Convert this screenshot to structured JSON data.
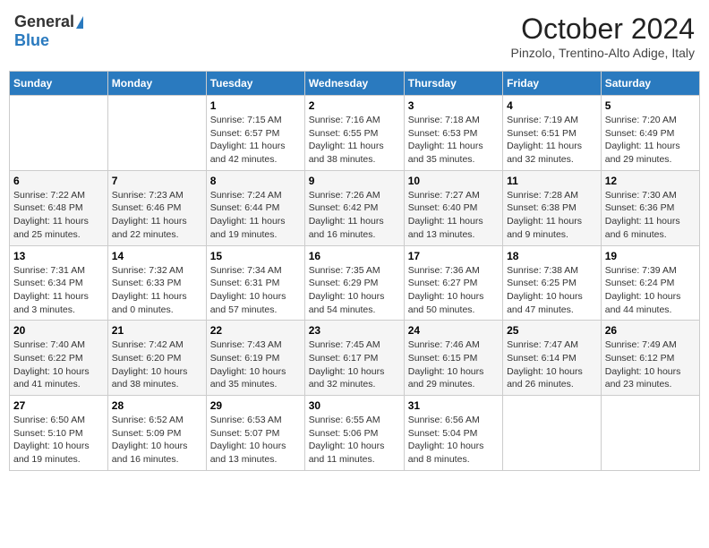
{
  "header": {
    "logo_general": "General",
    "logo_blue": "Blue",
    "month_title": "October 2024",
    "subtitle": "Pinzolo, Trentino-Alto Adige, Italy"
  },
  "days_of_week": [
    "Sunday",
    "Monday",
    "Tuesday",
    "Wednesday",
    "Thursday",
    "Friday",
    "Saturday"
  ],
  "weeks": [
    [
      {
        "day": "",
        "sunrise": "",
        "sunset": "",
        "daylight": ""
      },
      {
        "day": "",
        "sunrise": "",
        "sunset": "",
        "daylight": ""
      },
      {
        "day": "1",
        "sunrise": "Sunrise: 7:15 AM",
        "sunset": "Sunset: 6:57 PM",
        "daylight": "Daylight: 11 hours and 42 minutes."
      },
      {
        "day": "2",
        "sunrise": "Sunrise: 7:16 AM",
        "sunset": "Sunset: 6:55 PM",
        "daylight": "Daylight: 11 hours and 38 minutes."
      },
      {
        "day": "3",
        "sunrise": "Sunrise: 7:18 AM",
        "sunset": "Sunset: 6:53 PM",
        "daylight": "Daylight: 11 hours and 35 minutes."
      },
      {
        "day": "4",
        "sunrise": "Sunrise: 7:19 AM",
        "sunset": "Sunset: 6:51 PM",
        "daylight": "Daylight: 11 hours and 32 minutes."
      },
      {
        "day": "5",
        "sunrise": "Sunrise: 7:20 AM",
        "sunset": "Sunset: 6:49 PM",
        "daylight": "Daylight: 11 hours and 29 minutes."
      }
    ],
    [
      {
        "day": "6",
        "sunrise": "Sunrise: 7:22 AM",
        "sunset": "Sunset: 6:48 PM",
        "daylight": "Daylight: 11 hours and 25 minutes."
      },
      {
        "day": "7",
        "sunrise": "Sunrise: 7:23 AM",
        "sunset": "Sunset: 6:46 PM",
        "daylight": "Daylight: 11 hours and 22 minutes."
      },
      {
        "day": "8",
        "sunrise": "Sunrise: 7:24 AM",
        "sunset": "Sunset: 6:44 PM",
        "daylight": "Daylight: 11 hours and 19 minutes."
      },
      {
        "day": "9",
        "sunrise": "Sunrise: 7:26 AM",
        "sunset": "Sunset: 6:42 PM",
        "daylight": "Daylight: 11 hours and 16 minutes."
      },
      {
        "day": "10",
        "sunrise": "Sunrise: 7:27 AM",
        "sunset": "Sunset: 6:40 PM",
        "daylight": "Daylight: 11 hours and 13 minutes."
      },
      {
        "day": "11",
        "sunrise": "Sunrise: 7:28 AM",
        "sunset": "Sunset: 6:38 PM",
        "daylight": "Daylight: 11 hours and 9 minutes."
      },
      {
        "day": "12",
        "sunrise": "Sunrise: 7:30 AM",
        "sunset": "Sunset: 6:36 PM",
        "daylight": "Daylight: 11 hours and 6 minutes."
      }
    ],
    [
      {
        "day": "13",
        "sunrise": "Sunrise: 7:31 AM",
        "sunset": "Sunset: 6:34 PM",
        "daylight": "Daylight: 11 hours and 3 minutes."
      },
      {
        "day": "14",
        "sunrise": "Sunrise: 7:32 AM",
        "sunset": "Sunset: 6:33 PM",
        "daylight": "Daylight: 11 hours and 0 minutes."
      },
      {
        "day": "15",
        "sunrise": "Sunrise: 7:34 AM",
        "sunset": "Sunset: 6:31 PM",
        "daylight": "Daylight: 10 hours and 57 minutes."
      },
      {
        "day": "16",
        "sunrise": "Sunrise: 7:35 AM",
        "sunset": "Sunset: 6:29 PM",
        "daylight": "Daylight: 10 hours and 54 minutes."
      },
      {
        "day": "17",
        "sunrise": "Sunrise: 7:36 AM",
        "sunset": "Sunset: 6:27 PM",
        "daylight": "Daylight: 10 hours and 50 minutes."
      },
      {
        "day": "18",
        "sunrise": "Sunrise: 7:38 AM",
        "sunset": "Sunset: 6:25 PM",
        "daylight": "Daylight: 10 hours and 47 minutes."
      },
      {
        "day": "19",
        "sunrise": "Sunrise: 7:39 AM",
        "sunset": "Sunset: 6:24 PM",
        "daylight": "Daylight: 10 hours and 44 minutes."
      }
    ],
    [
      {
        "day": "20",
        "sunrise": "Sunrise: 7:40 AM",
        "sunset": "Sunset: 6:22 PM",
        "daylight": "Daylight: 10 hours and 41 minutes."
      },
      {
        "day": "21",
        "sunrise": "Sunrise: 7:42 AM",
        "sunset": "Sunset: 6:20 PM",
        "daylight": "Daylight: 10 hours and 38 minutes."
      },
      {
        "day": "22",
        "sunrise": "Sunrise: 7:43 AM",
        "sunset": "Sunset: 6:19 PM",
        "daylight": "Daylight: 10 hours and 35 minutes."
      },
      {
        "day": "23",
        "sunrise": "Sunrise: 7:45 AM",
        "sunset": "Sunset: 6:17 PM",
        "daylight": "Daylight: 10 hours and 32 minutes."
      },
      {
        "day": "24",
        "sunrise": "Sunrise: 7:46 AM",
        "sunset": "Sunset: 6:15 PM",
        "daylight": "Daylight: 10 hours and 29 minutes."
      },
      {
        "day": "25",
        "sunrise": "Sunrise: 7:47 AM",
        "sunset": "Sunset: 6:14 PM",
        "daylight": "Daylight: 10 hours and 26 minutes."
      },
      {
        "day": "26",
        "sunrise": "Sunrise: 7:49 AM",
        "sunset": "Sunset: 6:12 PM",
        "daylight": "Daylight: 10 hours and 23 minutes."
      }
    ],
    [
      {
        "day": "27",
        "sunrise": "Sunrise: 6:50 AM",
        "sunset": "Sunset: 5:10 PM",
        "daylight": "Daylight: 10 hours and 19 minutes."
      },
      {
        "day": "28",
        "sunrise": "Sunrise: 6:52 AM",
        "sunset": "Sunset: 5:09 PM",
        "daylight": "Daylight: 10 hours and 16 minutes."
      },
      {
        "day": "29",
        "sunrise": "Sunrise: 6:53 AM",
        "sunset": "Sunset: 5:07 PM",
        "daylight": "Daylight: 10 hours and 13 minutes."
      },
      {
        "day": "30",
        "sunrise": "Sunrise: 6:55 AM",
        "sunset": "Sunset: 5:06 PM",
        "daylight": "Daylight: 10 hours and 11 minutes."
      },
      {
        "day": "31",
        "sunrise": "Sunrise: 6:56 AM",
        "sunset": "Sunset: 5:04 PM",
        "daylight": "Daylight: 10 hours and 8 minutes."
      },
      {
        "day": "",
        "sunrise": "",
        "sunset": "",
        "daylight": ""
      },
      {
        "day": "",
        "sunrise": "",
        "sunset": "",
        "daylight": ""
      }
    ]
  ]
}
